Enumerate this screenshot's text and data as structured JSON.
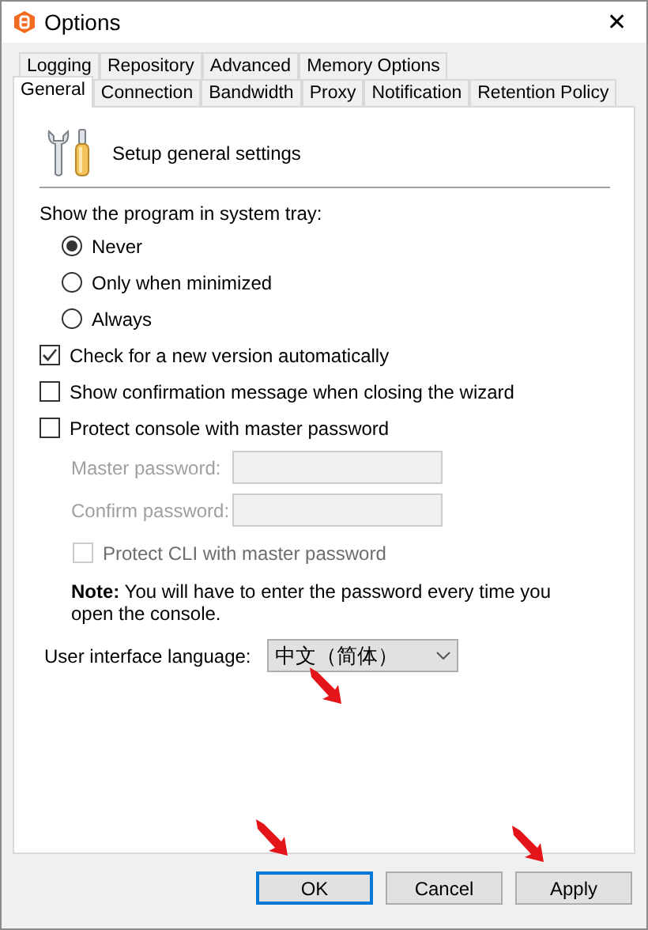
{
  "window": {
    "title": "Options",
    "close": "✕"
  },
  "tab_rows": [
    [
      {
        "label": "Logging",
        "selected": false
      },
      {
        "label": "Repository",
        "selected": false
      },
      {
        "label": "Advanced",
        "selected": false
      },
      {
        "label": "Memory Options",
        "selected": false
      }
    ],
    [
      {
        "label": "General",
        "selected": true
      },
      {
        "label": "Connection",
        "selected": false
      },
      {
        "label": "Bandwidth",
        "selected": false
      },
      {
        "label": "Proxy",
        "selected": false
      },
      {
        "label": "Notification",
        "selected": false
      },
      {
        "label": "Retention Policy",
        "selected": false
      }
    ]
  ],
  "header": {
    "text": "Setup general settings"
  },
  "tray": {
    "label": "Show the program in system tray:",
    "options": [
      {
        "label": "Never",
        "selected": true
      },
      {
        "label": "Only when minimized",
        "selected": false
      },
      {
        "label": "Always",
        "selected": false
      }
    ]
  },
  "checkboxes": [
    {
      "label": "Check for a new version automatically",
      "checked": true
    },
    {
      "label": "Show confirmation message when closing the wizard",
      "checked": false
    },
    {
      "label": "Protect console with master password",
      "checked": false
    }
  ],
  "password_fields": [
    {
      "label": "Master password:",
      "disabled": true
    },
    {
      "label": "Confirm password:",
      "disabled": true
    }
  ],
  "cli_checkbox": {
    "label": "Protect CLI with master password",
    "checked": false,
    "disabled": true
  },
  "note": "**Note:**  You will have to enter the password every time you open the console.",
  "language": {
    "label": "User interface language:",
    "value": "中文（简体）"
  },
  "buttons": [
    {
      "label": "OK",
      "default": true
    },
    {
      "label": "Cancel",
      "default": false
    },
    {
      "label": "Apply",
      "default": false
    }
  ]
}
